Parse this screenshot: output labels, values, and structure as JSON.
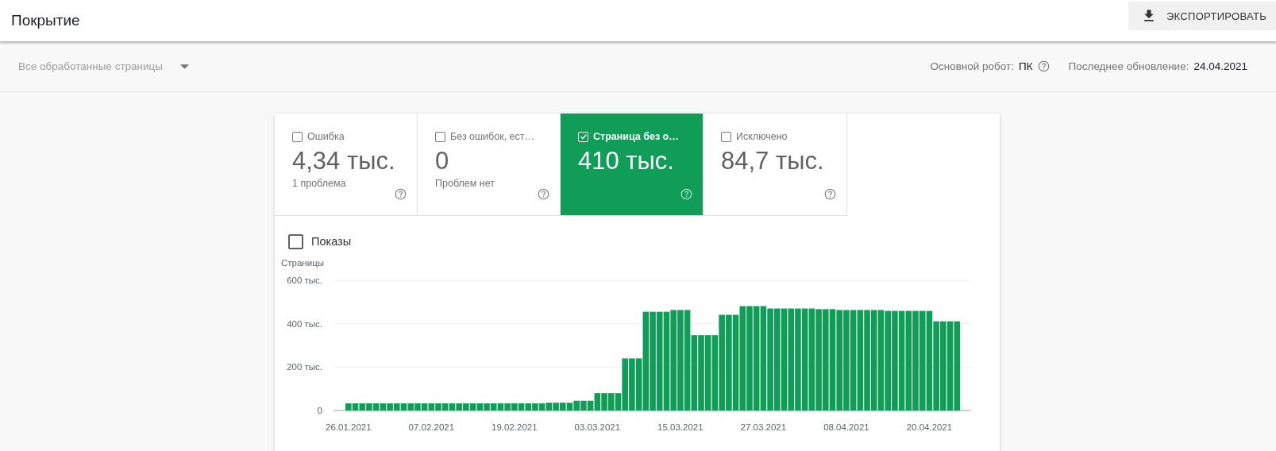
{
  "header": {
    "title": "Покрытие",
    "export_button": "ЭКСПОРТИРОВАТЬ"
  },
  "filter": {
    "dropdown": "Все обработанные страницы",
    "crawler_label": "Основной робот:",
    "crawler_value": "ПК",
    "updated_label": "Последнее обновление:",
    "updated_value": "24.04.2021"
  },
  "tiles": [
    {
      "label": "Ошибка",
      "value": "4,34 тыс.",
      "sublabel": "1 проблема",
      "selected": false
    },
    {
      "label": "Без ошибок, ест…",
      "value": "0",
      "sublabel": "Проблем нет",
      "selected": false
    },
    {
      "label": "Страница без о…",
      "value": "410 тыс.",
      "selected": true
    },
    {
      "label": "Исключено",
      "value": "84,7 тыс.",
      "selected": false
    }
  ],
  "impressions": {
    "label": "Показы",
    "checked": false
  },
  "chart_data": {
    "type": "bar",
    "ylabel": "Страницы",
    "ylim": [
      0,
      600
    ],
    "yticks": [
      {
        "value": 0,
        "label": "0"
      },
      {
        "value": 200,
        "label": "200 тыс."
      },
      {
        "value": 400,
        "label": "400 тыс."
      },
      {
        "value": 600,
        "label": "600 тыс."
      }
    ],
    "categories": [
      "26.01.2021",
      null,
      null,
      null,
      null,
      null,
      null,
      null,
      null,
      null,
      null,
      null,
      "07.02.2021",
      null,
      null,
      null,
      null,
      null,
      null,
      null,
      null,
      null,
      null,
      null,
      "19.02.2021",
      null,
      null,
      null,
      null,
      null,
      null,
      null,
      null,
      null,
      null,
      null,
      "03.03.2021",
      null,
      null,
      null,
      null,
      null,
      null,
      null,
      null,
      null,
      null,
      null,
      "15.03.2021",
      null,
      null,
      null,
      null,
      null,
      null,
      null,
      null,
      null,
      null,
      null,
      "27.03.2021",
      null,
      null,
      null,
      null,
      null,
      null,
      null,
      null,
      null,
      null,
      null,
      "08.04.2021",
      null,
      null,
      null,
      null,
      null,
      null,
      null,
      null,
      null,
      null,
      null,
      "20.04.2021",
      null,
      null,
      null,
      null
    ],
    "series": [
      {
        "color": "#0f9d58",
        "values": [
          33,
          33,
          33,
          33,
          33,
          33,
          33,
          33,
          33,
          33,
          33,
          33,
          33,
          33,
          33,
          33,
          33,
          33,
          33,
          33,
          33,
          33,
          33,
          33,
          33,
          33,
          33,
          33,
          33,
          36,
          36,
          36,
          36,
          45,
          45,
          45,
          80,
          80,
          80,
          80,
          240,
          240,
          240,
          455,
          455,
          455,
          455,
          463,
          463,
          463,
          347,
          347,
          347,
          347,
          441,
          441,
          441,
          481,
          481,
          481,
          481,
          470,
          470,
          470,
          470,
          470,
          470,
          470,
          467,
          467,
          467,
          463,
          463,
          463,
          463,
          463,
          463,
          463,
          459,
          459,
          459,
          459,
          459,
          459,
          459,
          411,
          411,
          411,
          411
        ]
      }
    ]
  }
}
